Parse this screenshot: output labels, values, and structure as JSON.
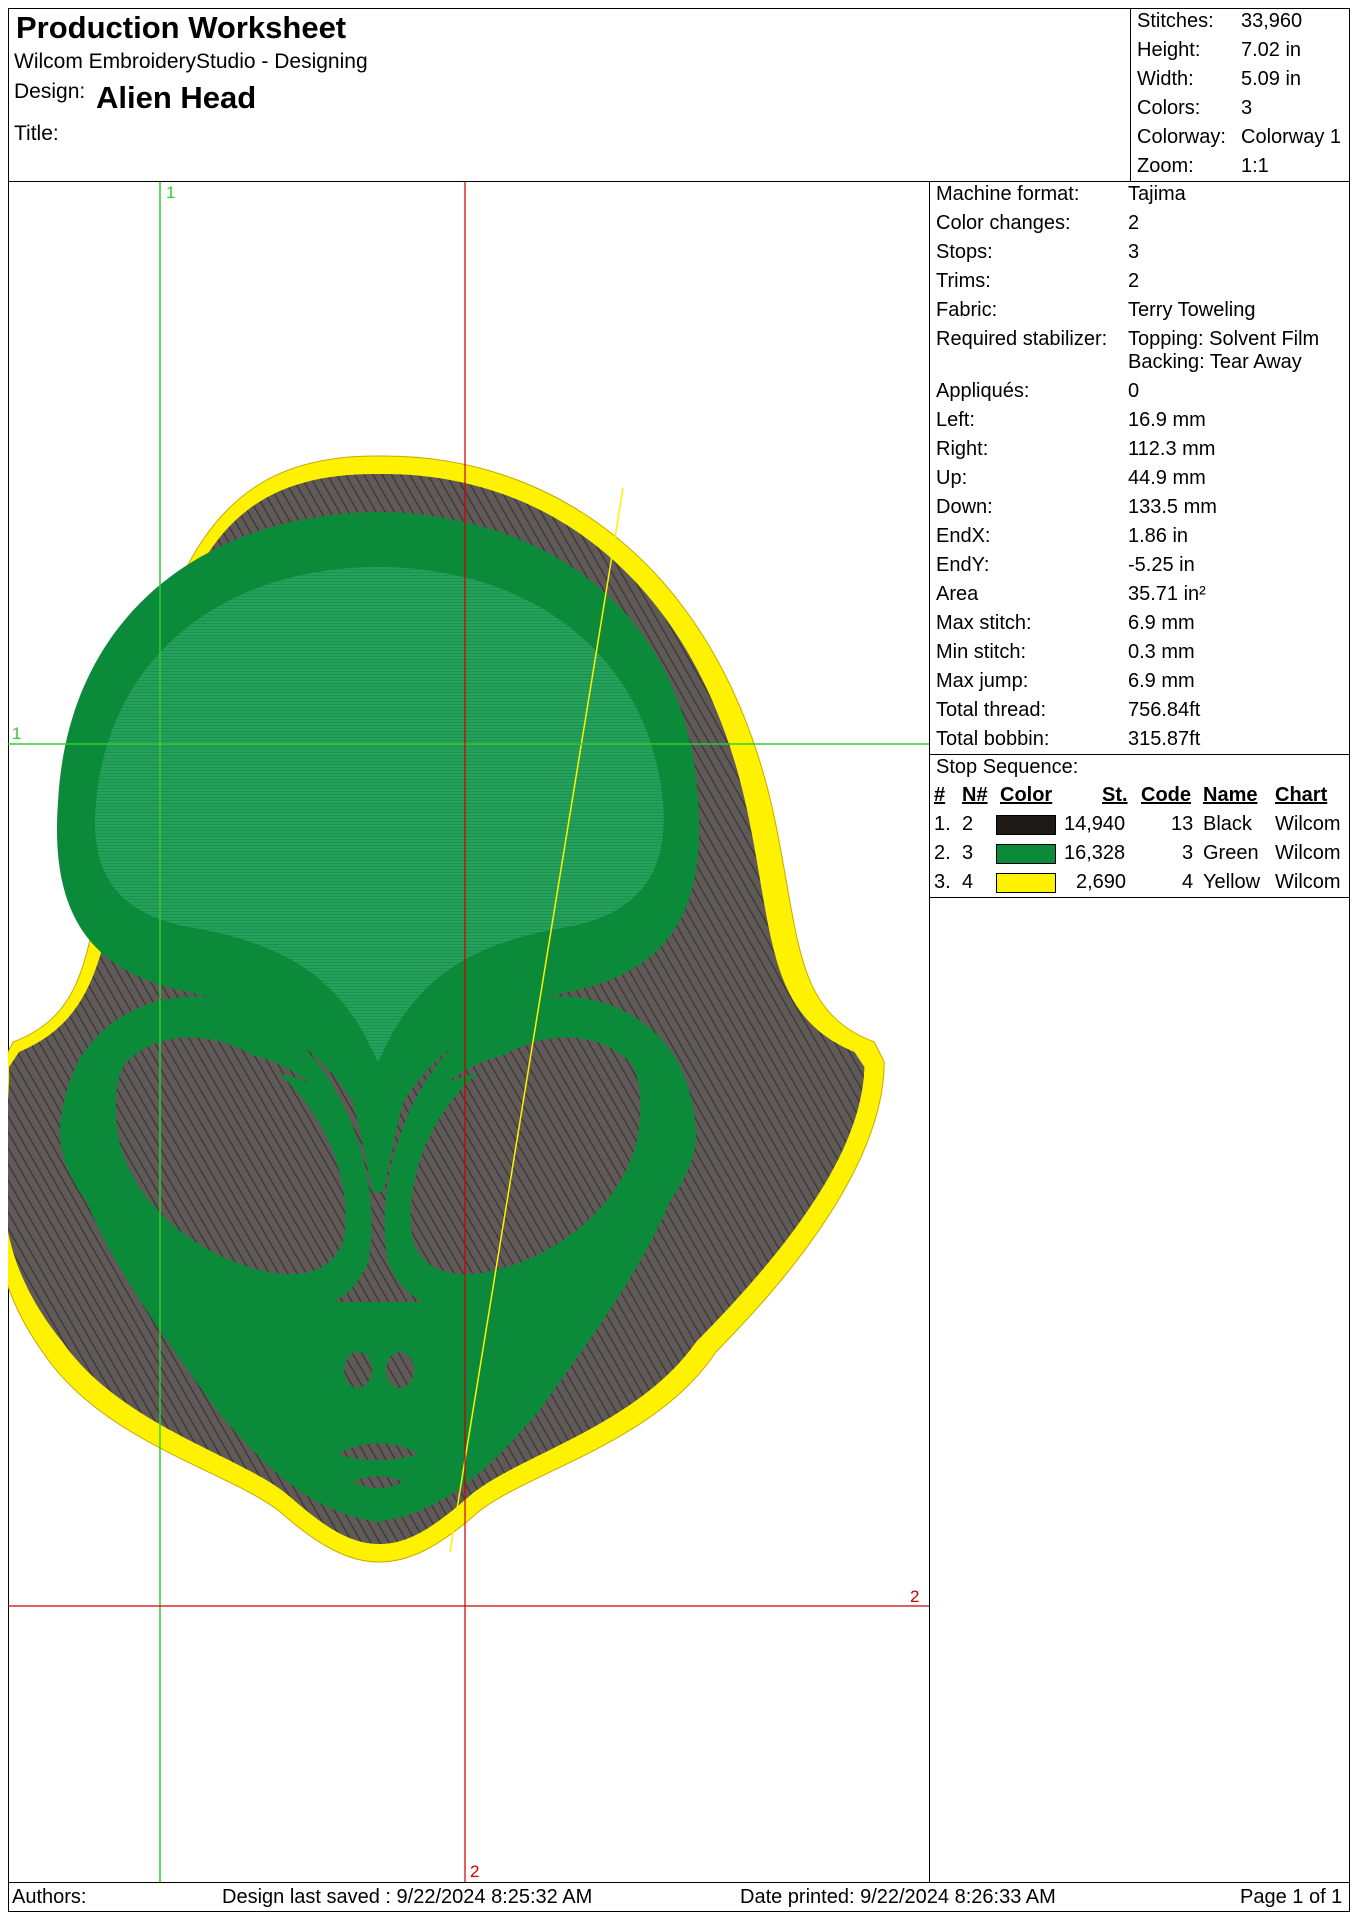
{
  "header": {
    "title": "Production Worksheet",
    "subtitle": "Wilcom EmbroideryStudio - Designing",
    "design_label": "Design:",
    "design_name": "Alien Head",
    "title_label": "Title:",
    "stats": [
      {
        "label": "Stitches:",
        "value": "33,960"
      },
      {
        "label": "Height:",
        "value": "7.02 in"
      },
      {
        "label": "Width:",
        "value": "5.09 in"
      },
      {
        "label": "Colors:",
        "value": "3"
      },
      {
        "label": "Colorway:",
        "value": "Colorway 1"
      },
      {
        "label": "Zoom:",
        "value": "1:1"
      }
    ]
  },
  "canvas": {
    "guide_labels": {
      "green_top": "1",
      "green_left": "1",
      "red_right": "2",
      "red_bottom": "2"
    },
    "colors": {
      "black": "#5f5a58",
      "green": "#0b8a3a",
      "yellow": "#fff200",
      "guide_green": "#33cc33",
      "guide_red": "#cc0000"
    }
  },
  "info": {
    "rows": [
      {
        "label": "Machine format:",
        "value": "Tajima"
      },
      {
        "label": "Color changes:",
        "value": "2"
      },
      {
        "label": "Stops:",
        "value": "3"
      },
      {
        "label": "Trims:",
        "value": "2"
      },
      {
        "label": "Fabric:",
        "value": "Terry Toweling"
      },
      {
        "label": "Required stabilizer:",
        "value": "Topping: Solvent Film"
      },
      {
        "label": "",
        "value": "Backing: Tear Away"
      },
      {
        "label": "Appliqués:",
        "value": "0"
      },
      {
        "label": "Left:",
        "value": "16.9 mm"
      },
      {
        "label": "Right:",
        "value": "112.3 mm"
      },
      {
        "label": "Up:",
        "value": "44.9 mm"
      },
      {
        "label": "Down:",
        "value": "133.5 mm"
      },
      {
        "label": "EndX:",
        "value": "1.86 in"
      },
      {
        "label": "EndY:",
        "value": "-5.25 in"
      },
      {
        "label": "Area",
        "value": " 35.71 in²"
      },
      {
        "label": "Max stitch:",
        "value": "6.9 mm"
      },
      {
        "label": "Min stitch:",
        "value": "0.3 mm"
      },
      {
        "label": "Max jump:",
        "value": "6.9 mm"
      },
      {
        "label": "Total thread:",
        "value": "756.84ft"
      },
      {
        "label": "Total bobbin:",
        "value": "315.87ft"
      }
    ],
    "stop_sequence_title": "Stop Sequence:",
    "columns": [
      "#",
      "N#",
      "Color",
      "St.",
      "Code",
      "Name",
      "Chart"
    ],
    "stops": [
      {
        "num": "1.",
        "n": "2",
        "color": "#1e1a18",
        "stitches": "14,940",
        "code": "13",
        "name": "Black",
        "chart": "Wilcom"
      },
      {
        "num": "2.",
        "n": "3",
        "color": "#0b8a3a",
        "stitches": "16,328",
        "code": "3",
        "name": "Green",
        "chart": "Wilcom"
      },
      {
        "num": "3.",
        "n": "4",
        "color": "#fff200",
        "stitches": "2,690",
        "code": "4",
        "name": "Yellow",
        "chart": "Wilcom"
      }
    ]
  },
  "footer": {
    "authors": "Authors:",
    "saved": "Design last saved : 9/22/2024 8:25:32 AM",
    "printed": "Date printed: 9/22/2024 8:26:33 AM",
    "page": "Page 1 of 1"
  }
}
